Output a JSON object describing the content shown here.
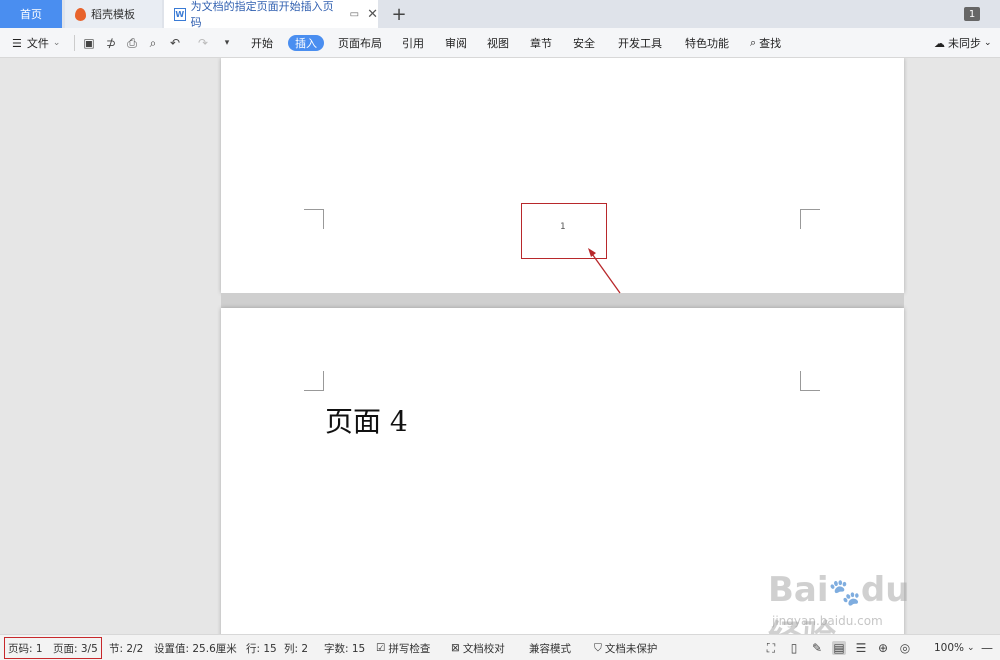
{
  "tabs": {
    "home": "首页",
    "template": "稻壳模板",
    "document": "为文档的指定页面开始插入页码",
    "count": "1"
  },
  "menu": {
    "file": "文件",
    "items": [
      "开始",
      "插入",
      "页面布局",
      "引用",
      "审阅",
      "视图",
      "章节",
      "安全",
      "开发工具",
      "特色功能"
    ],
    "active": "插入",
    "search": "查找",
    "sync": "未同步"
  },
  "document": {
    "page_number": "1",
    "page2_heading": "页面 4"
  },
  "status": {
    "page_code": "页码: 1",
    "page_of": "页面: 3/5",
    "section": "节: 2/2",
    "setting": "设置值: 25.6厘米",
    "row": "行: 15",
    "col": "列: 2",
    "words": "字数: 15",
    "spell": "拼写检查",
    "proof": "文档校对",
    "compat": "兼容模式",
    "protect": "文档未保护",
    "zoom": "100%"
  },
  "watermark": {
    "text": "Bai du 经验",
    "sub": "jingyan.baidu.com"
  },
  "colors": {
    "accent": "#4a8ef0",
    "highlight": "#c7282b"
  }
}
